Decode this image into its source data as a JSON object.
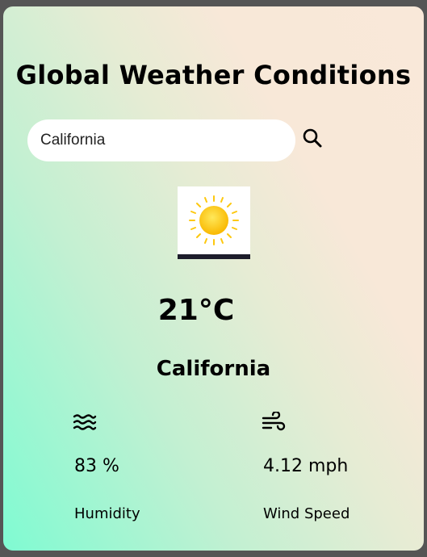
{
  "app": {
    "title": "Global Weather Conditions"
  },
  "search": {
    "value": "California",
    "placeholder": "",
    "icon": "search-icon"
  },
  "weather": {
    "condition_icon": "sun-icon",
    "temperature": "21°C",
    "city": "California"
  },
  "stats": {
    "humidity": {
      "icon": "humidity-waves-icon",
      "value": "83 %",
      "label": "Humidity"
    },
    "wind": {
      "icon": "wind-icon",
      "value": "4.12 mph",
      "label": "Wind Speed"
    }
  },
  "colors": {
    "background": "#555555",
    "card_gradient_start": "#7ffbd2",
    "card_gradient_end": "#f9e8d9",
    "sun": "#fdc80f"
  }
}
